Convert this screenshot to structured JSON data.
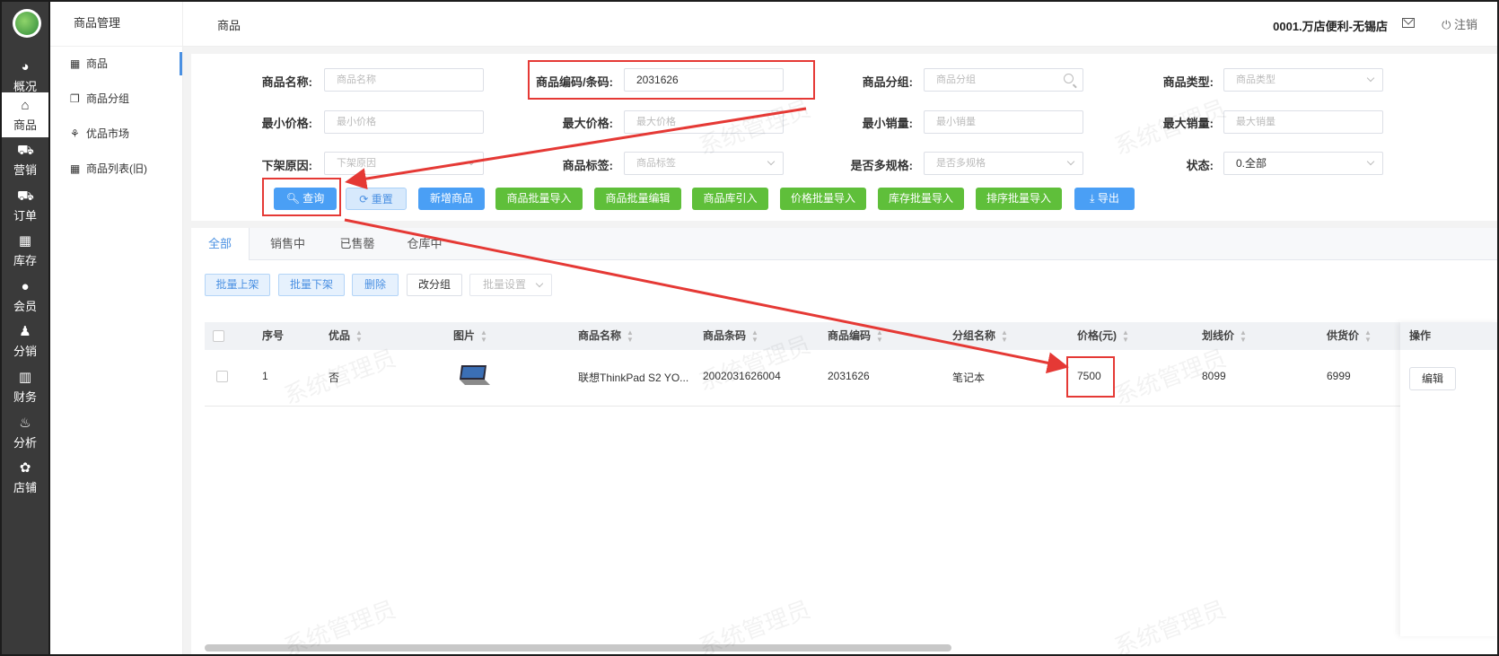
{
  "rail": {
    "items": [
      {
        "label": "概况",
        "icon": "dashboard-icon"
      },
      {
        "label": "商品",
        "icon": "product-icon"
      },
      {
        "label": "营销",
        "icon": "cart-icon"
      },
      {
        "label": "订单",
        "icon": "order-icon"
      },
      {
        "label": "库存",
        "icon": "inventory-icon"
      },
      {
        "label": "会员",
        "icon": "member-icon"
      },
      {
        "label": "分销",
        "icon": "distribution-icon"
      },
      {
        "label": "财务",
        "icon": "finance-icon"
      },
      {
        "label": "分析",
        "icon": "analysis-icon"
      },
      {
        "label": "店铺",
        "icon": "store-icon"
      }
    ]
  },
  "sidebar": {
    "title": "商品管理",
    "items": [
      {
        "label": "商品",
        "icon": "grid-icon"
      },
      {
        "label": "商品分组",
        "icon": "copy-icon"
      },
      {
        "label": "优品市场",
        "icon": "tree-icon"
      },
      {
        "label": "商品列表(旧)",
        "icon": "grid-icon"
      }
    ]
  },
  "topbar": {
    "breadcrumb": "商品",
    "store": "0001.万店便利-无锡店",
    "logout": "注销"
  },
  "filters": {
    "name_label": "商品名称:",
    "name_placeholder": "商品名称",
    "code_label": "商品编码/条码:",
    "code_value": "2031626",
    "group_label": "商品分组:",
    "group_placeholder": "商品分组",
    "type_label": "商品类型:",
    "type_placeholder": "商品类型",
    "minprice_label": "最小价格:",
    "minprice_placeholder": "最小价格",
    "maxprice_label": "最大价格:",
    "maxprice_placeholder": "最大价格",
    "minsales_label": "最小销量:",
    "minsales_placeholder": "最小销量",
    "maxsales_label": "最大销量:",
    "maxsales_placeholder": "最大销量",
    "reason_label": "下架原因:",
    "reason_placeholder": "下架原因",
    "tag_label": "商品标签:",
    "tag_placeholder": "商品标签",
    "spec_label": "是否多规格:",
    "spec_placeholder": "是否多规格",
    "status_label": "状态:",
    "status_value": "0.全部"
  },
  "actions": {
    "query": "查询",
    "reset": "重置",
    "add": "新增商品",
    "bulk_import": "商品批量导入",
    "bulk_edit": "商品批量编辑",
    "lib_import": "商品库引入",
    "price_import": "价格批量导入",
    "stock_import": "库存批量导入",
    "sort_import": "排序批量导入",
    "export": "导出"
  },
  "tabs": [
    "全部",
    "销售中",
    "已售罄",
    "仓库中"
  ],
  "table_actions": {
    "on_shelf": "批量上架",
    "off_shelf": "批量下架",
    "delete": "删除",
    "regroup": "改分组",
    "bulk_settings": "批量设置"
  },
  "table": {
    "headers": [
      "序号",
      "优品",
      "图片",
      "商品名称",
      "商品条码",
      "商品编码",
      "分组名称",
      "价格(元)",
      "划线价",
      "供货价",
      "操作"
    ],
    "rows": [
      {
        "index": "1",
        "featured": "否",
        "name": "联想ThinkPad S2 YO...",
        "barcode": "2002031626004",
        "code": "2031626",
        "group": "笔记本",
        "price": "7500",
        "list_price": "8099",
        "supply_price": "6999",
        "op": "编辑"
      }
    ]
  },
  "watermark": "系统管理员",
  "colors": {
    "primary": "#4a9ff5",
    "success": "#5fbf3a",
    "rail": "#3a3a3a",
    "annotation": "#e53935"
  }
}
